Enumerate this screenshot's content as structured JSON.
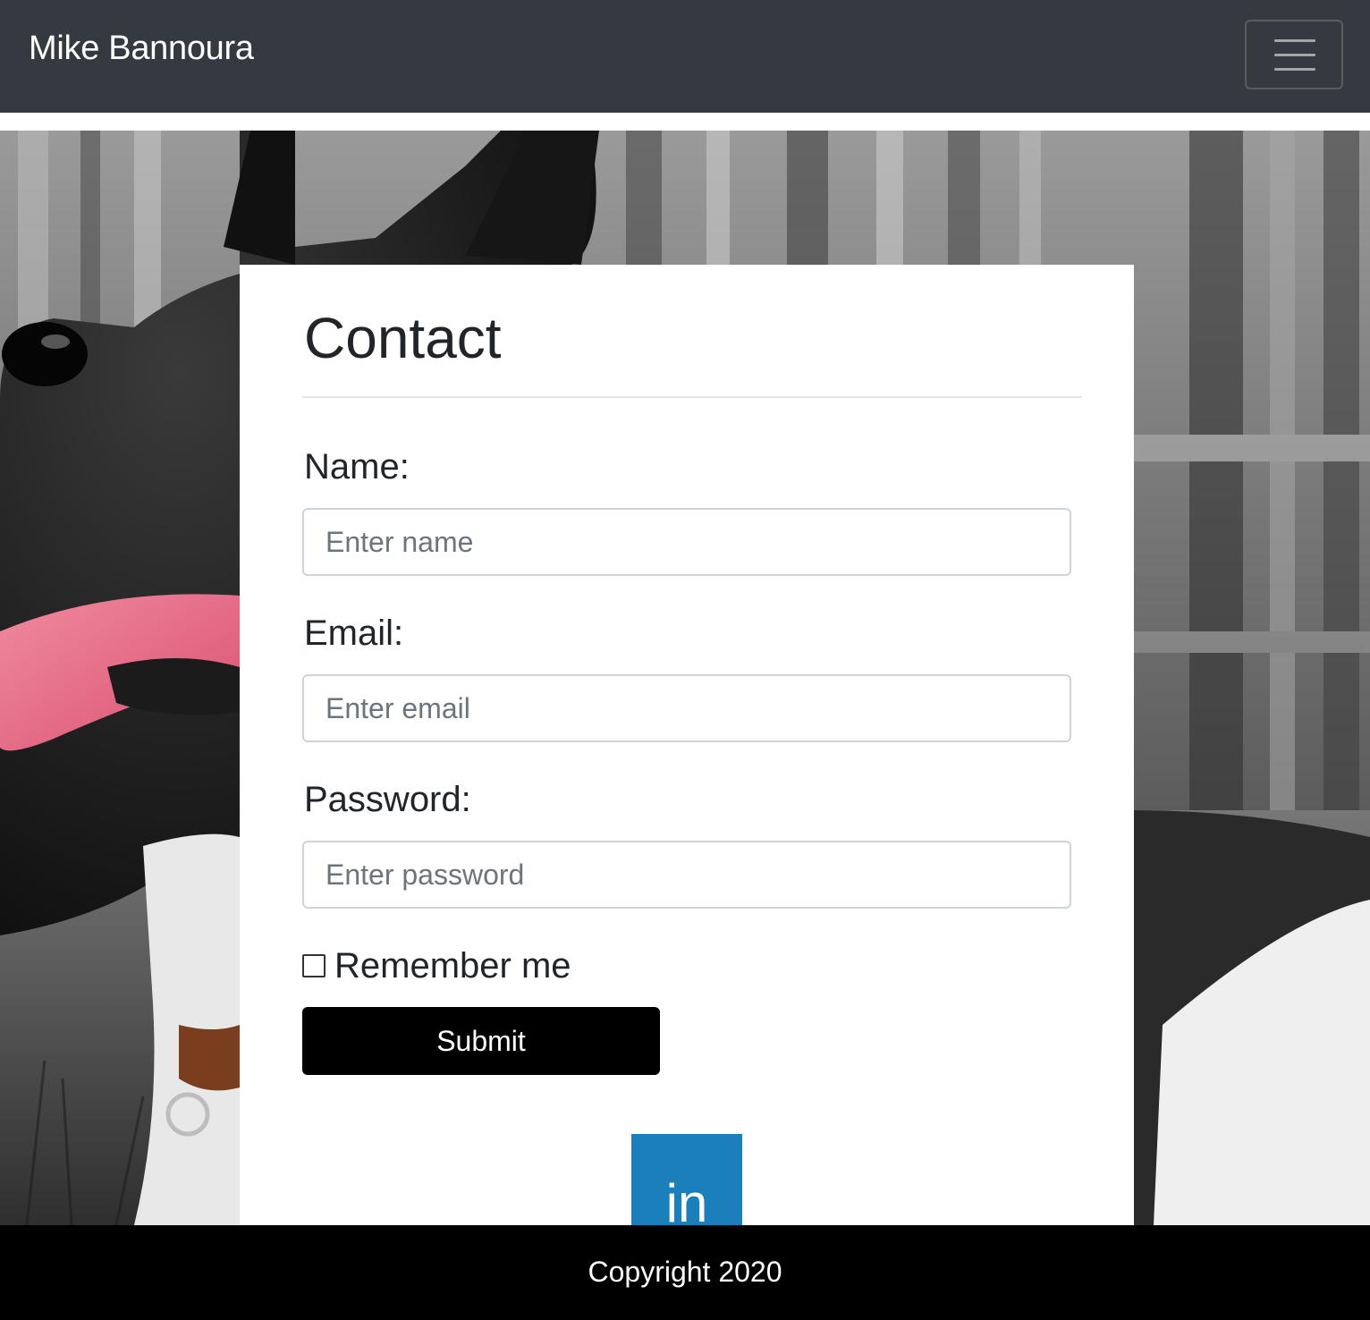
{
  "navbar": {
    "brand": "Mike Bannoura",
    "toggler_icon": "hamburger-menu-icon"
  },
  "contact": {
    "title": "Contact",
    "name_label": "Name:",
    "name_placeholder": "Enter name",
    "email_label": "Email:",
    "email_placeholder": "Enter email",
    "password_label": "Password:",
    "password_placeholder": "Enter password",
    "remember_label": "Remember me",
    "remember_checked": false,
    "submit_label": "Submit",
    "social_icon": "linkedin-icon",
    "social_text": "in"
  },
  "footer": {
    "copyright": "Copyright 2020"
  },
  "colors": {
    "navbar": "#343a40",
    "footer": "#000000",
    "submit_button": "#000000",
    "linkedin": "#1a7fbb",
    "tongue_accent": "#e06a86"
  }
}
